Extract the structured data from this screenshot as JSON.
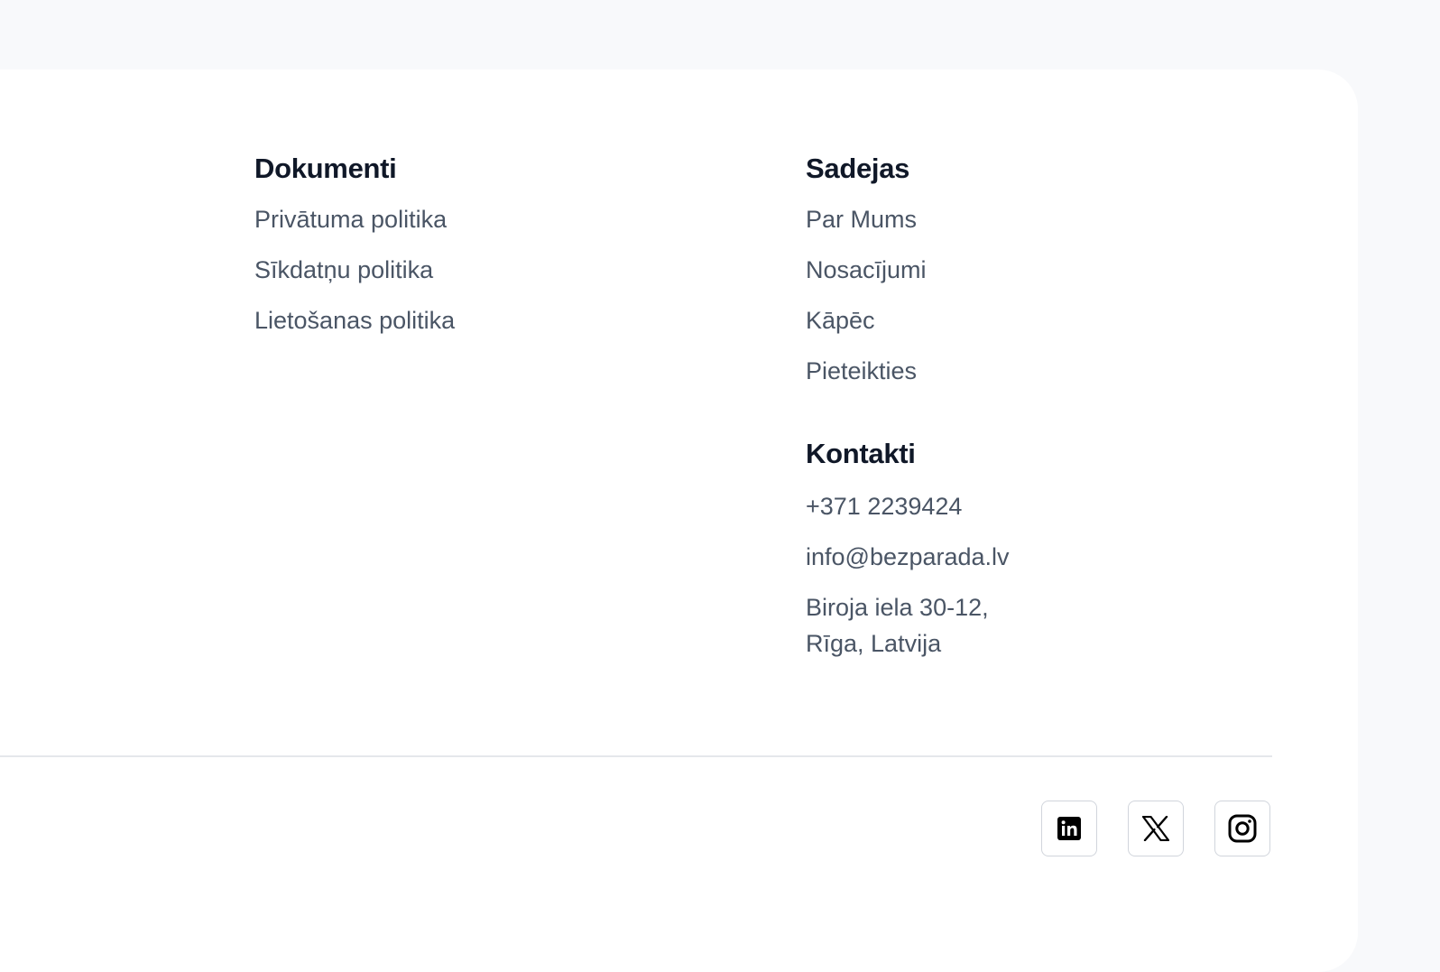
{
  "documents": {
    "heading": "Dokumenti",
    "links": [
      "Privātuma politika",
      "Sīkdatņu politika",
      "Lietošanas politika"
    ]
  },
  "sadejas": {
    "heading": "Sadejas",
    "links": [
      "Par Mums",
      "Nosacījumi",
      "Kāpēc",
      "Pieteikties"
    ]
  },
  "kontakti": {
    "heading": "Kontakti",
    "phone": "+371 2239424",
    "email": "info@bezparada.lv",
    "address_line1": "Biroja iela 30-12,",
    "address_line2": "Rīga, Latvija"
  },
  "social": {
    "icons": [
      "linkedin-icon",
      "x-icon",
      "instagram-icon"
    ]
  },
  "colors": {
    "page_background": "#f8f9fb",
    "card_background": "#ffffff",
    "heading": "#101828",
    "link": "#4a5565",
    "divider": "#e5e7eb"
  }
}
